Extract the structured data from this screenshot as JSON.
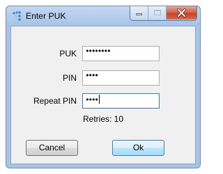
{
  "window": {
    "title": "Enter PUK",
    "icon": "app-dots-icon",
    "controls": [
      "minimize-icon",
      "maximize-icon",
      "close-icon"
    ]
  },
  "form": {
    "puk_label": "PUK",
    "puk_value": "••••••••",
    "pin_label": "PIN",
    "pin_value": "••••",
    "repeat_pin_label": "Repeat PIN",
    "repeat_pin_value": "••••",
    "retries_text": "Retries: 10"
  },
  "buttons": {
    "cancel_label": "Cancel",
    "ok_label": "Ok"
  },
  "colors": {
    "frame": "#a9c4e6",
    "close_button": "#c44528",
    "default_button_border": "#3c7fb1"
  }
}
